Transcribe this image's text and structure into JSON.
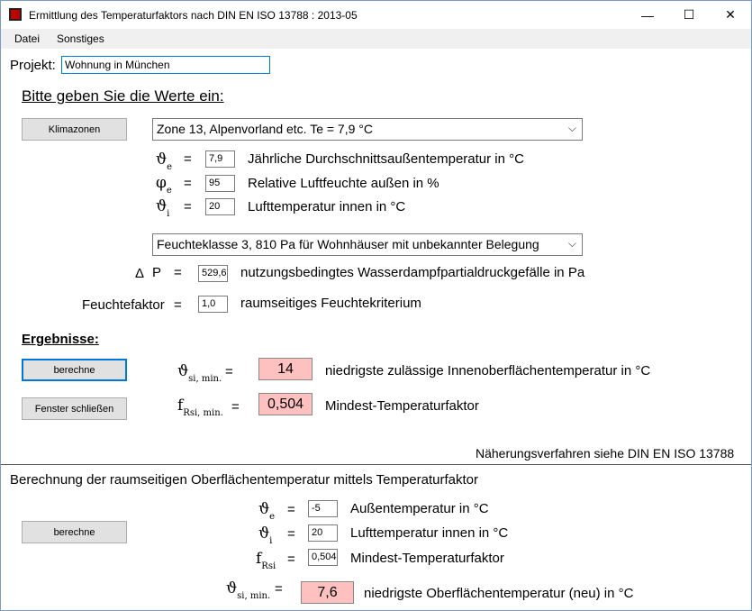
{
  "window": {
    "title": "Ermittlung des Temperaturfaktors nach DIN EN ISO 13788 : 2013-05",
    "minimize": "—",
    "maximize": "☐",
    "close": "✕"
  },
  "menu": {
    "file": "Datei",
    "other": "Sonstiges"
  },
  "project": {
    "label": "Projekt:",
    "value": "Wohnung in München"
  },
  "input_heading": "Bitte geben Sie die Werte ein:",
  "climate": {
    "button": "Klimazonen",
    "zone_selected": "Zone 13, Alpenvorland etc. Te = 7,9 °C",
    "theta_e": {
      "symbol": "ϑ",
      "sub": "e",
      "eq": "=",
      "value": "7,9",
      "desc": "Jährliche Durchschnittsaußentemperatur in °C"
    },
    "phi_e": {
      "symbol": "φ",
      "sub": "e",
      "eq": "=",
      "value": "95",
      "desc": "Relative Luftfeuchte außen in %"
    },
    "theta_i": {
      "symbol": "ϑ",
      "sub": "i",
      "eq": "=",
      "value": "20",
      "desc": "Lufttemperatur innen in °C"
    }
  },
  "moisture": {
    "class_selected": "Feuchteklasse 3, 810 Pa für Wohnhäuser mit unbekannter Belegung",
    "delta_p": {
      "symbol": "Δ",
      "label": "P",
      "eq": "=",
      "value": "529,6",
      "desc": "nutzungsbedingtes Wasserdampfpartialdruckgefälle in Pa"
    },
    "factor": {
      "label": "Feuchtefaktor",
      "eq": "=",
      "value": "1,0",
      "desc": "raumseitiges Feuchtekriterium"
    }
  },
  "results": {
    "heading": "Ergebnisse:",
    "calc_button": "berechne",
    "close_button": "Fenster schließen",
    "theta_si": {
      "symbol": "ϑ",
      "sub": "si, min.",
      "eq": "=",
      "value": "14",
      "desc": "niedrigste zulässige Innenoberflächentemperatur in °C"
    },
    "f_rsi": {
      "symbol": "f",
      "sub": "Rsi, min.",
      "eq": "=",
      "value": "0,504",
      "desc": "Mindest-Temperaturfaktor"
    },
    "note": "Näherungsverfahren siehe DIN EN ISO 13788"
  },
  "section2": {
    "heading": "Berechnung der raumseitigen Oberflächentemperatur mittels Temperaturfaktor",
    "calc_button": "berechne",
    "theta_e": {
      "symbol": "ϑ",
      "sub": "e",
      "eq": "=",
      "value": "-5",
      "desc": "Außentemperatur in °C"
    },
    "theta_i": {
      "symbol": "ϑ",
      "sub": "i",
      "eq": "=",
      "value": "20",
      "desc": "Lufttemperatur innen in °C"
    },
    "f_rsi": {
      "symbol": "f",
      "sub": "Rsi",
      "eq": "=",
      "value": "0,504",
      "desc": "Mindest-Temperaturfaktor"
    },
    "theta_si": {
      "symbol": "ϑ",
      "sub": "si, min.",
      "eq": "=",
      "value": "7,6",
      "desc": "niedrigste Oberflächentemperatur (neu) in °C"
    }
  }
}
